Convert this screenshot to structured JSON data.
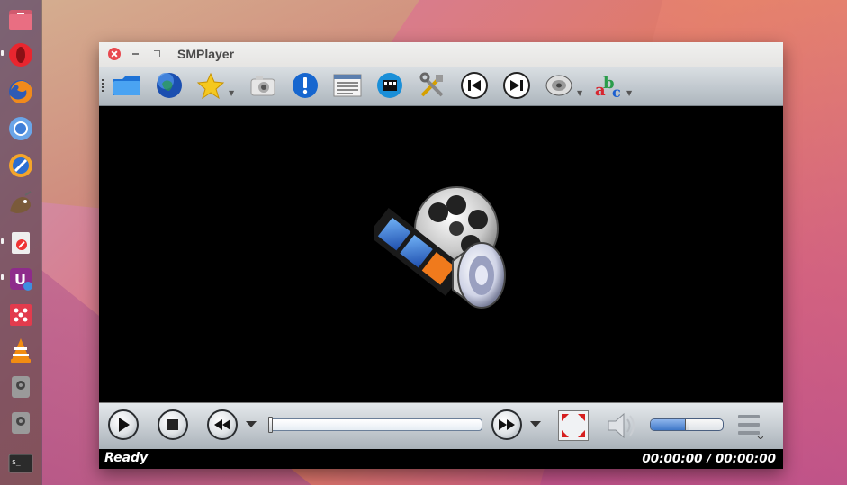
{
  "window": {
    "title": "SMPlayer"
  },
  "launcher": {
    "items": [
      "Files",
      "Opera",
      "Firefox",
      "Chromium",
      "Firefox Developer",
      "GIMP",
      "Text Editor",
      "Ubuntu Software",
      "Screenshot",
      "VLC",
      "Disk",
      "Disk",
      "Terminal"
    ]
  },
  "toolbar": {
    "items": [
      "open-folder",
      "open-url",
      "favorites",
      "screenshot",
      "info",
      "playlist",
      "video-filters",
      "preferences",
      "previous",
      "next",
      "audio-track",
      "subtitles"
    ]
  },
  "controls": {
    "seek_fraction": 0.0,
    "volume_fraction": 0.5
  },
  "status": {
    "text": "Ready",
    "time": "00:00:00 / 00:00:00"
  },
  "colors": {
    "close_button": "#e8494f",
    "toolbar_bg": "#c3cad0",
    "video_bg": "#000000",
    "volume_fill": "#3f78c8"
  }
}
